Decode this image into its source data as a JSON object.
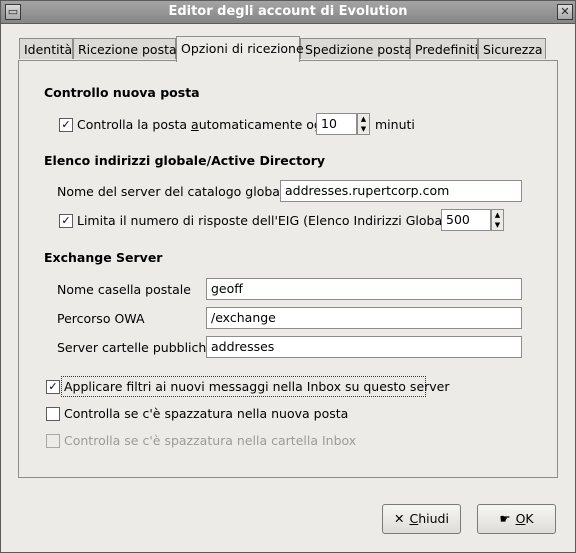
{
  "window": {
    "title": "Editor degli account di Evolution"
  },
  "tabs": [
    {
      "label": "Identità"
    },
    {
      "label": "Ricezione posta"
    },
    {
      "label": "Opzioni di ricezione"
    },
    {
      "label": "Spedizione posta"
    },
    {
      "label": "Predefiniti"
    },
    {
      "label": "Sicurezza"
    }
  ],
  "check_mail": {
    "heading": "Controllo nuova posta",
    "auto_check_label_before": "Controlla la posta ",
    "auto_check_label_mnemonic": "a",
    "auto_check_label_after": "utomaticamente ogni",
    "auto_check_checked": true,
    "interval_value": "10",
    "interval_unit": "minuti"
  },
  "gal": {
    "heading": "Elenco indirizzi globale/Active Directory",
    "server_label": "Nome del server del catalogo globale:",
    "server_value": "addresses.rupertcorp.com",
    "limit_label": "Limita il numero di risposte dell'EIG (Elenco Indirizzi Globale):",
    "limit_checked": true,
    "limit_value": "500"
  },
  "exchange": {
    "heading": "Exchange Server",
    "mailbox_label": "Nome casella postale",
    "mailbox_value": "geoff",
    "owa_label": "Percorso OWA",
    "owa_value": "/exchange",
    "public_label": "Server cartelle pubbliche",
    "public_value": "addresses"
  },
  "options": [
    {
      "label": "Applicare filtri ai nuovi messaggi nella Inbox su questo server",
      "checked": true,
      "disabled": false
    },
    {
      "label": "Controlla se c'è spazzatura nella nuova posta",
      "checked": false,
      "disabled": false
    },
    {
      "label": "Controlla se c'è spazzatura nella cartella Inbox",
      "checked": false,
      "disabled": true
    }
  ],
  "buttons": {
    "close_mnemonic": "C",
    "close_rest": "hiudi",
    "ok_mnemonic": "O",
    "ok_rest": "K"
  },
  "icons": {
    "window_menu": "window-menu-icon",
    "close": "close-x-icon",
    "ok": "ok-hand-icon",
    "check": "✓"
  }
}
